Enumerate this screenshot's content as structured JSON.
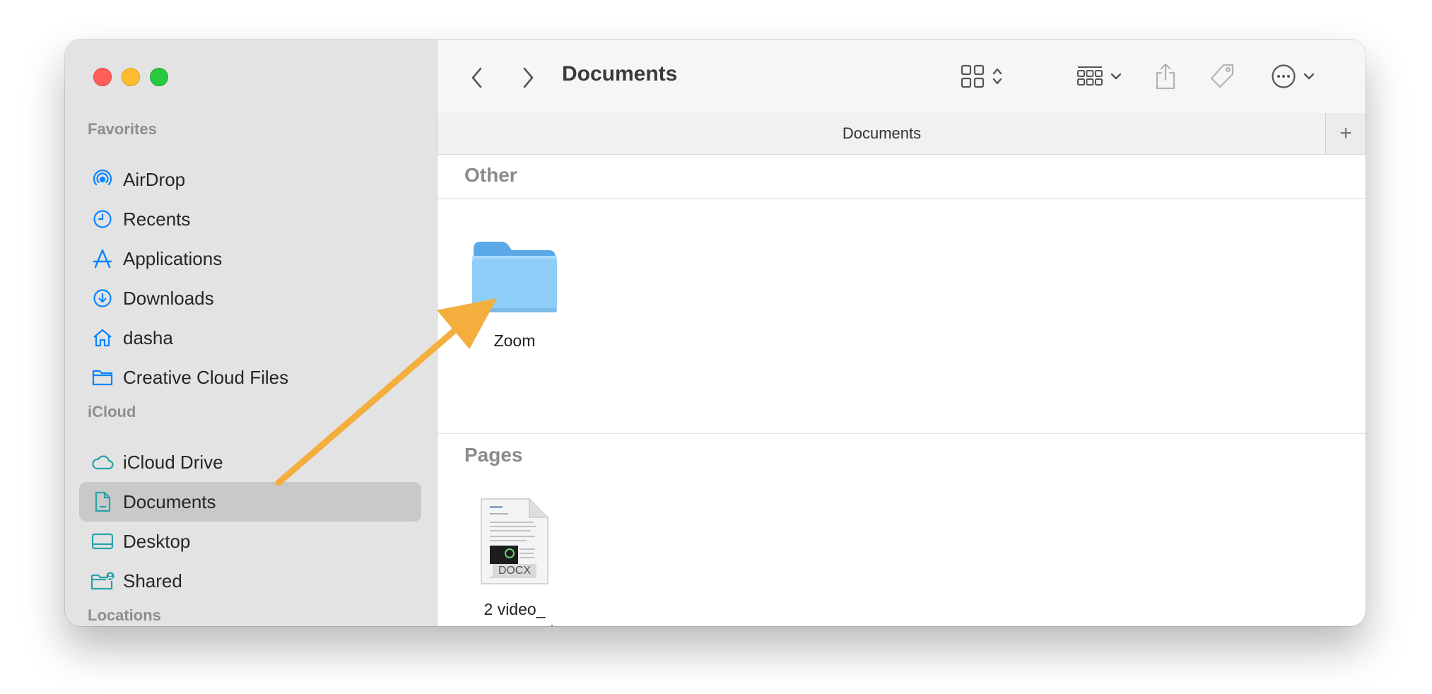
{
  "sidebar": {
    "sections": {
      "favorites": "Favorites",
      "icloud": "iCloud",
      "locations": "Locations"
    },
    "favorites": [
      {
        "label": "AirDrop",
        "icon": "airdrop-icon"
      },
      {
        "label": "Recents",
        "icon": "clock-icon"
      },
      {
        "label": "Applications",
        "icon": "applications-icon"
      },
      {
        "label": "Downloads",
        "icon": "download-icon"
      },
      {
        "label": "dasha",
        "icon": "home-icon"
      },
      {
        "label": "Creative Cloud Files",
        "icon": "folder-icon"
      }
    ],
    "icloud": [
      {
        "label": "iCloud Drive",
        "icon": "cloud-icon"
      },
      {
        "label": "Documents",
        "icon": "document-icon",
        "selected": true
      },
      {
        "label": "Desktop",
        "icon": "desktop-icon"
      },
      {
        "label": "Shared",
        "icon": "shared-folder-icon"
      }
    ]
  },
  "toolbar": {
    "title": "Documents"
  },
  "tabbar": {
    "title": "Documents",
    "add_label": "+"
  },
  "groups": {
    "other": {
      "title": "Other",
      "items": [
        {
          "name": "Zoom",
          "type": "folder"
        }
      ]
    },
    "pages": {
      "title": "Pages",
      "items": [
        {
          "name_line1": "2 video_",
          "name_line2": "MeetGe...r_ .docx",
          "badge": "DOCX",
          "type": "docx"
        }
      ]
    }
  },
  "colors": {
    "accent": "#0a84ff",
    "icloud_icon": "#2aa3a8",
    "arrow": "#f3ae3d",
    "folder": "#8ecdf7"
  }
}
